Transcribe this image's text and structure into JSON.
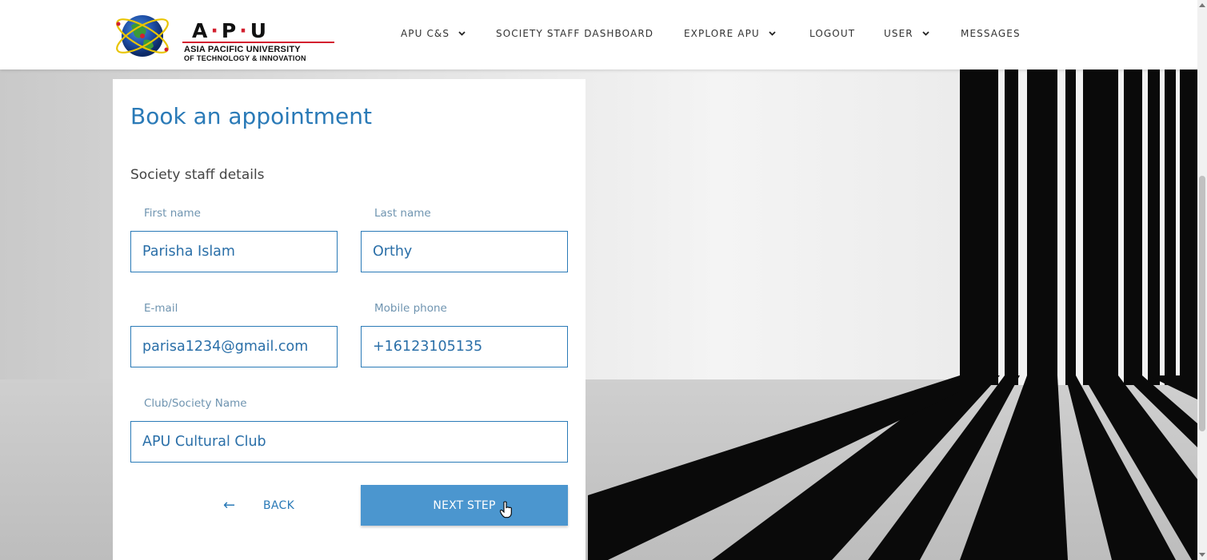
{
  "header": {
    "logo": {
      "wordmark_a": "A",
      "wordmark_p": "P",
      "wordmark_u": "U",
      "line1": "ASIA PACIFIC UNIVERSITY",
      "line2": "OF TECHNOLOGY & INNOVATION"
    },
    "nav": [
      {
        "label": "APU C&S",
        "has_dropdown": true
      },
      {
        "label": "SOCIETY STAFF DASHBOARD",
        "has_dropdown": false
      },
      {
        "label": "EXPLORE APU",
        "has_dropdown": true
      },
      {
        "label": "LOGOUT",
        "has_dropdown": false
      },
      {
        "label": "USER",
        "has_dropdown": true
      },
      {
        "label": "MESSAGES",
        "has_dropdown": false
      }
    ]
  },
  "form": {
    "title": "Book an appointment",
    "section": "Society staff details",
    "first_name": {
      "label": "First name",
      "value": "Parisha Islam"
    },
    "last_name": {
      "label": "Last name",
      "value": "Orthy"
    },
    "email": {
      "label": "E-mail",
      "value": "parisa1234@gmail.com"
    },
    "mobile": {
      "label": "Mobile phone",
      "value": "+16123105135"
    },
    "club": {
      "label": "Club/Society Name",
      "value": "APU Cultural Club"
    },
    "back_label": "BACK",
    "next_label": "NEXT STEP"
  },
  "icons": {
    "back": "arrow-left-icon",
    "dropdown": "chevron-down-icon",
    "cursor": "hand-pointer-icon"
  },
  "colors": {
    "accent": "#2a7ab7",
    "button": "#4b96cf",
    "label": "#6f94b0",
    "logo_red": "#d3202f"
  }
}
